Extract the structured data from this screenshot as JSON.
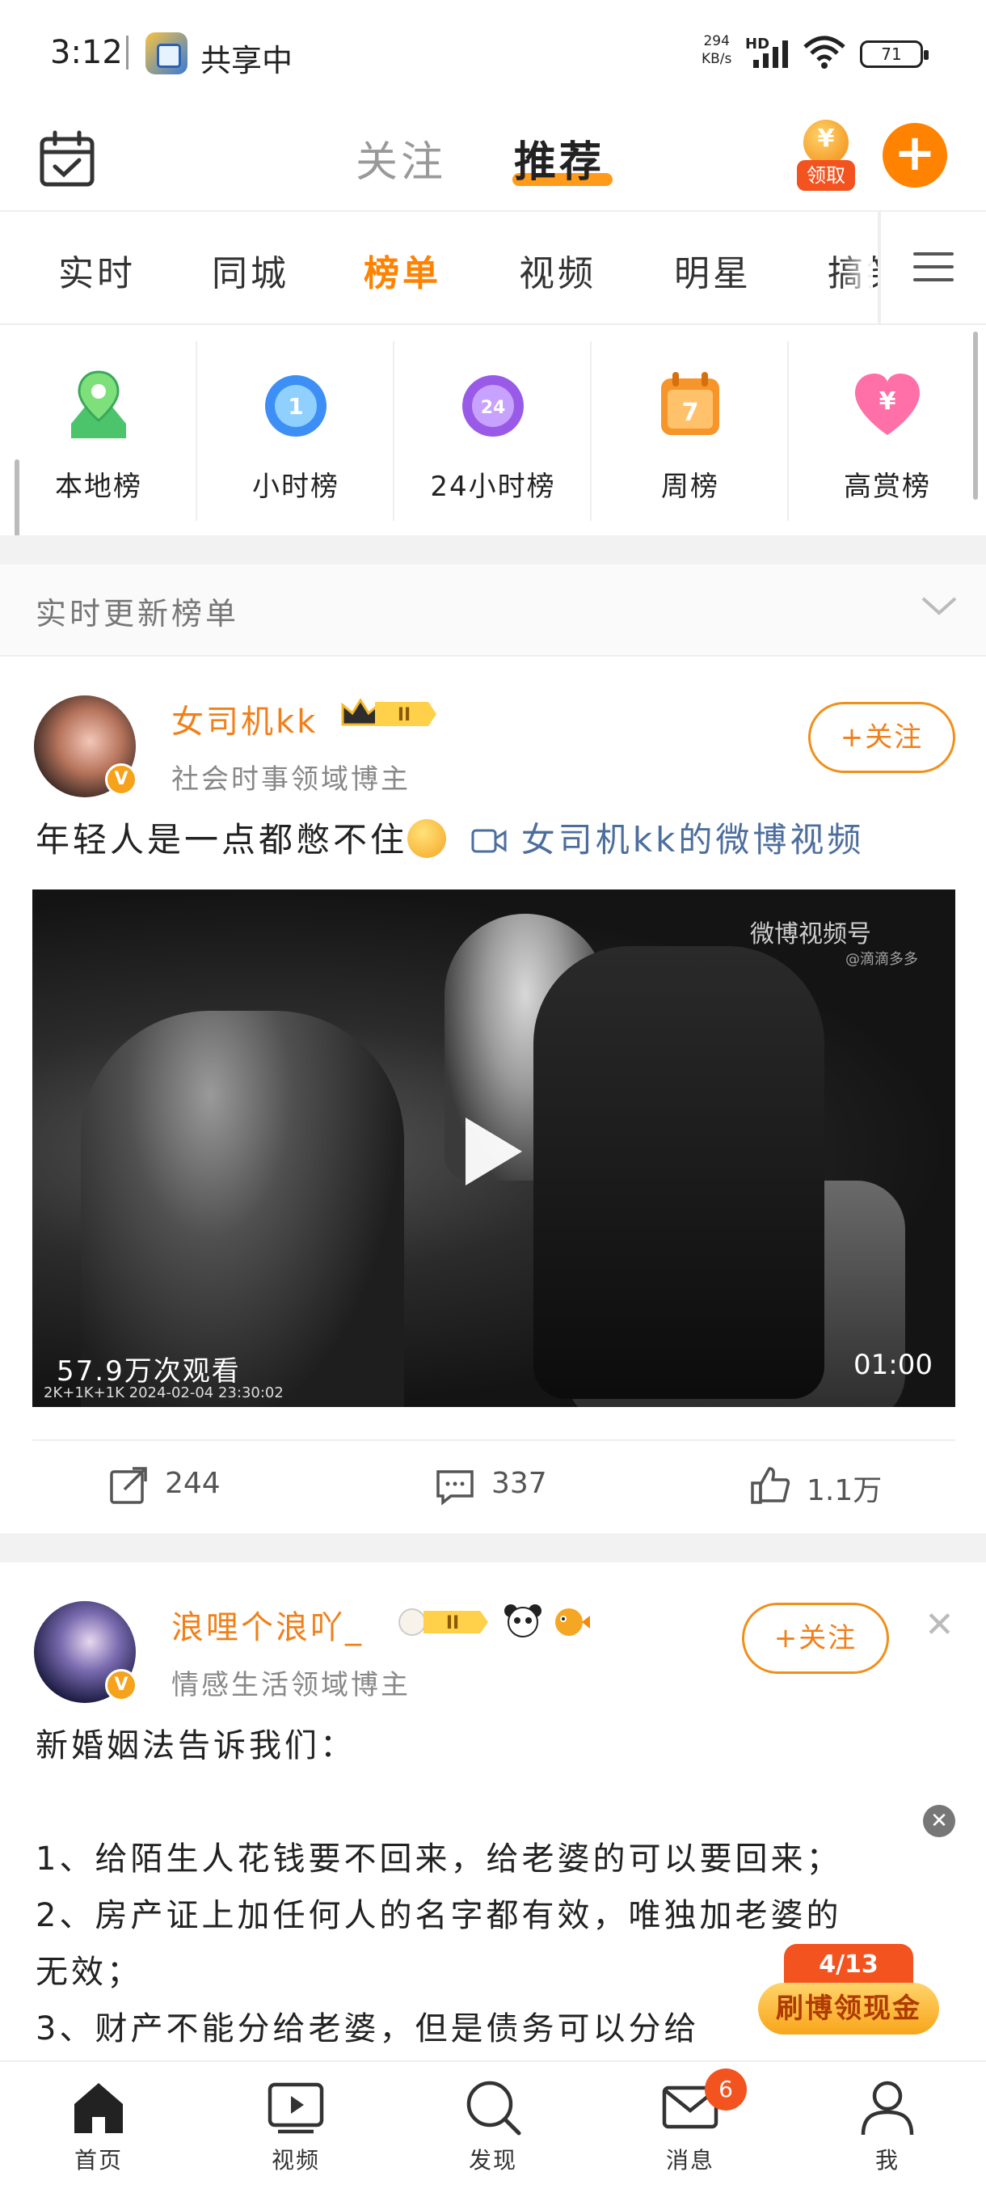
{
  "status_bar": {
    "time": "3:12",
    "sharing_label": "共享中",
    "net_speed_top": "294",
    "net_speed_unit": "KB/s",
    "hd": "HD",
    "battery": "71"
  },
  "header": {
    "tabs": [
      {
        "label": "关注",
        "active": false
      },
      {
        "label": "推荐",
        "active": true
      }
    ],
    "coupon_label": "领取",
    "accent_color": "#ff8200"
  },
  "channels": {
    "items": [
      {
        "label": "实时",
        "active": false
      },
      {
        "label": "同城",
        "active": false
      },
      {
        "label": "榜单",
        "active": true
      },
      {
        "label": "视频",
        "active": false
      },
      {
        "label": "明星",
        "active": false
      },
      {
        "label": "搞笑",
        "active": false
      }
    ]
  },
  "rank_categories": [
    {
      "label": "本地榜",
      "icon": "location-pin-icon",
      "icon_text": ""
    },
    {
      "label": "小时榜",
      "icon": "hour-clock-icon",
      "icon_text": "1"
    },
    {
      "label": "24小时榜",
      "icon": "day-clock-icon",
      "icon_text": "24"
    },
    {
      "label": "周榜",
      "icon": "week-calendar-icon",
      "icon_text": "7"
    },
    {
      "label": "高赏榜",
      "icon": "heart-reward-icon",
      "icon_text": "¥"
    }
  ],
  "realtime_banner": {
    "label": "实时更新榜单"
  },
  "posts": [
    {
      "author": "女司机kk",
      "level": "II",
      "subtitle": "社会时事领域博主",
      "follow_label": "+关注",
      "text": "年轻人是一点都憋不住",
      "video_link": "女司机kk的微博视频",
      "video": {
        "watermark": "微博视频号",
        "watermark_sub": "@滴滴多多",
        "views": "57.9万次观看",
        "duration": "01:00",
        "stamp": "2K+1K+1K  2024-02-04  23:30:02"
      },
      "actions": {
        "repost": "244",
        "comment": "337",
        "like": "1.1万"
      }
    },
    {
      "author": "浪哩个浪吖_",
      "level": "II",
      "subtitle": "情感生活领域博主",
      "follow_label": "+关注",
      "lines": [
        "新婚姻法告诉我们：",
        "",
        "1、给陌生人花钱要不回来，给老婆的可以要回来；",
        "2、房产证上加任何人的名字都有效，唯独加老婆的",
        "无效；",
        "3、财产不能分给老婆，但是债务可以分给"
      ]
    }
  ],
  "promo": {
    "progress": "4/13",
    "label": "刷博领现金"
  },
  "bottom_nav": {
    "items": [
      {
        "label": "首页",
        "icon": "home-icon"
      },
      {
        "label": "视频",
        "icon": "video-icon"
      },
      {
        "label": "发现",
        "icon": "discover-icon"
      },
      {
        "label": "消息",
        "icon": "message-icon",
        "badge": "6"
      },
      {
        "label": "我",
        "icon": "profile-icon"
      }
    ]
  }
}
